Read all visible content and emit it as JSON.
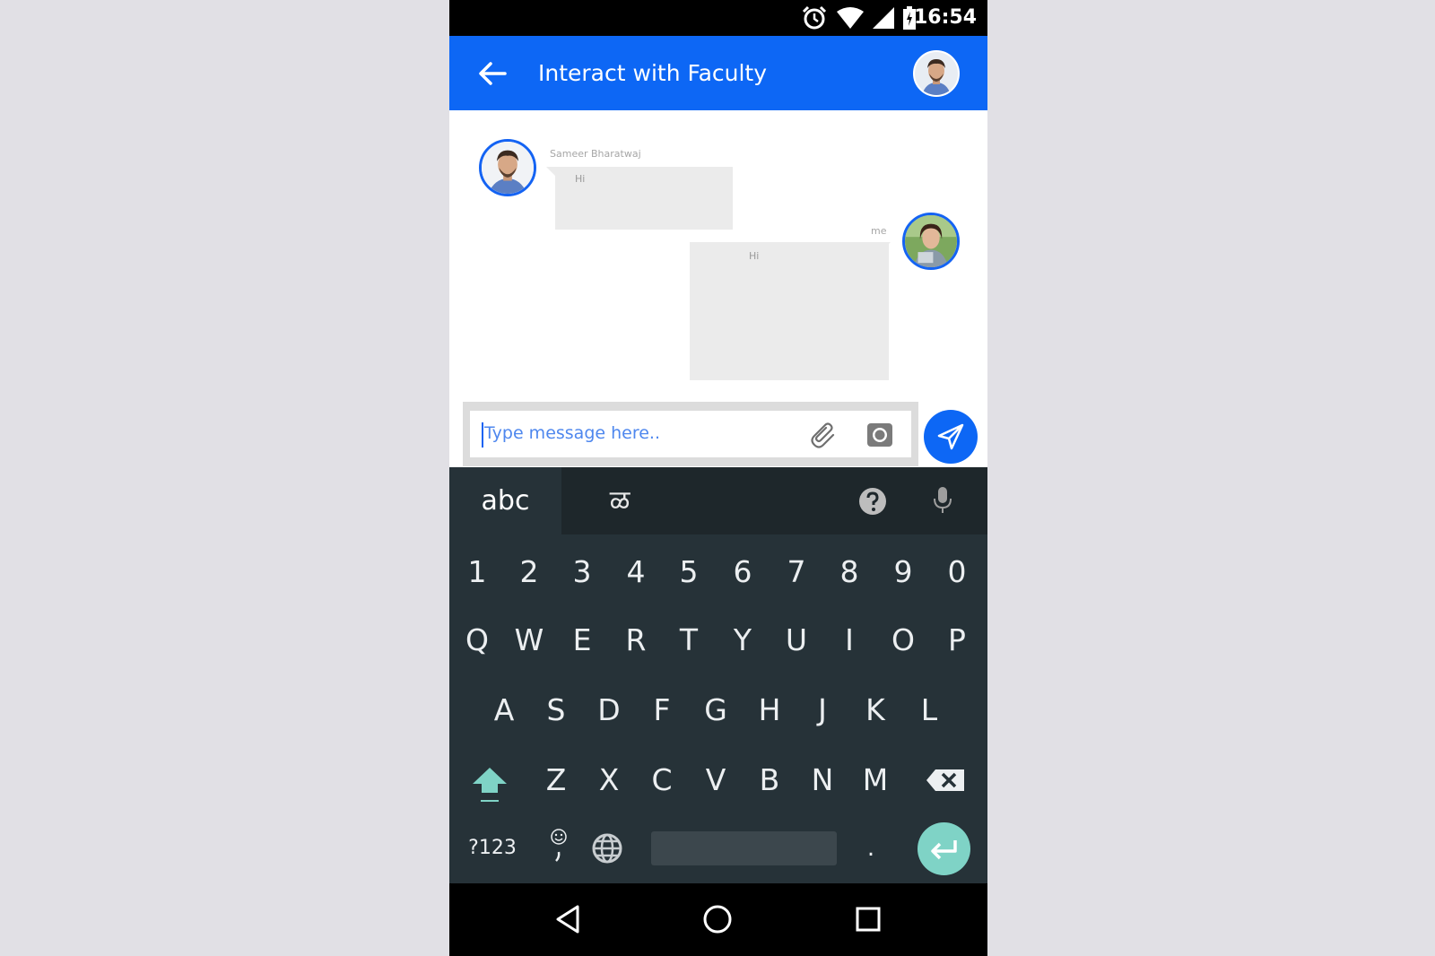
{
  "status_bar": {
    "time": "16:54"
  },
  "header": {
    "title": "Interact with Faculty"
  },
  "messages": [
    {
      "sender": "Sameer Bharatwaj",
      "text": "Hi",
      "side": "left"
    },
    {
      "sender": "me",
      "text": "Hi",
      "side": "right"
    }
  ],
  "composer": {
    "placeholder": "Type message here.."
  },
  "keyboard": {
    "mode_label": "abc",
    "language_label": "ळ",
    "number_row": [
      "1",
      "2",
      "3",
      "4",
      "5",
      "6",
      "7",
      "8",
      "9",
      "0"
    ],
    "row1": [
      "Q",
      "W",
      "E",
      "R",
      "T",
      "Y",
      "U",
      "I",
      "O",
      "P"
    ],
    "row2": [
      "A",
      "S",
      "D",
      "F",
      "G",
      "H",
      "J",
      "K",
      "L"
    ],
    "row3": [
      "Z",
      "X",
      "C",
      "V",
      "B",
      "N",
      "M"
    ],
    "symbols_label": "?123",
    "period_label": "."
  },
  "colors": {
    "primary": "#0d67f5",
    "keyboard_bg": "#263238",
    "enter_key": "#7fd3c6",
    "page_bg": "#e1e0e5"
  }
}
